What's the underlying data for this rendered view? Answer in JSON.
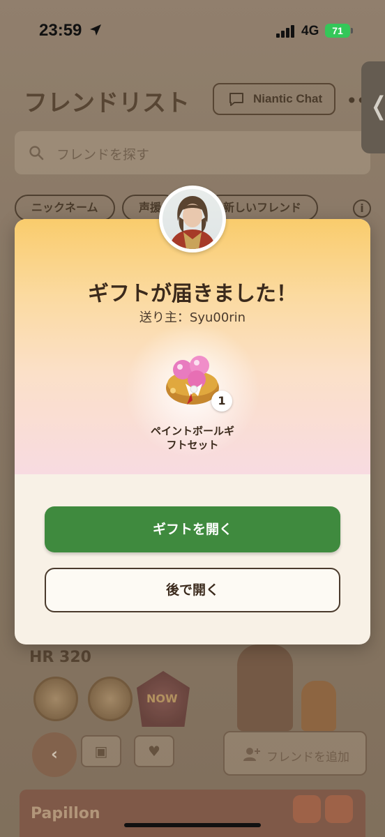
{
  "status_bar": {
    "time": "23:59",
    "network": "4G",
    "battery": "71"
  },
  "background": {
    "title": "フレンドリスト",
    "chat_button": "Niantic Chat",
    "search_placeholder": "フレンドを探す",
    "chips": [
      "ニックネーム",
      "声援",
      "新しいフレンド"
    ],
    "info_label": "i",
    "friend_card": {
      "hr": "HR 320",
      "badge_text": "NOW",
      "add_friend_label": "フレンドを追加"
    },
    "next_card_name": "Papillon"
  },
  "modal": {
    "title": "ギフトが届きました！",
    "sender": "送り主：Syu00rin",
    "item_name": "ペイントボールギフトセット",
    "quantity": "1",
    "open_button": "ギフトを開く",
    "later_button": "後で開く"
  },
  "colors": {
    "accent_green": "#3f8a3e",
    "modal_top": "#f9cc6c",
    "modal_bottom": "#f8dbe1"
  }
}
